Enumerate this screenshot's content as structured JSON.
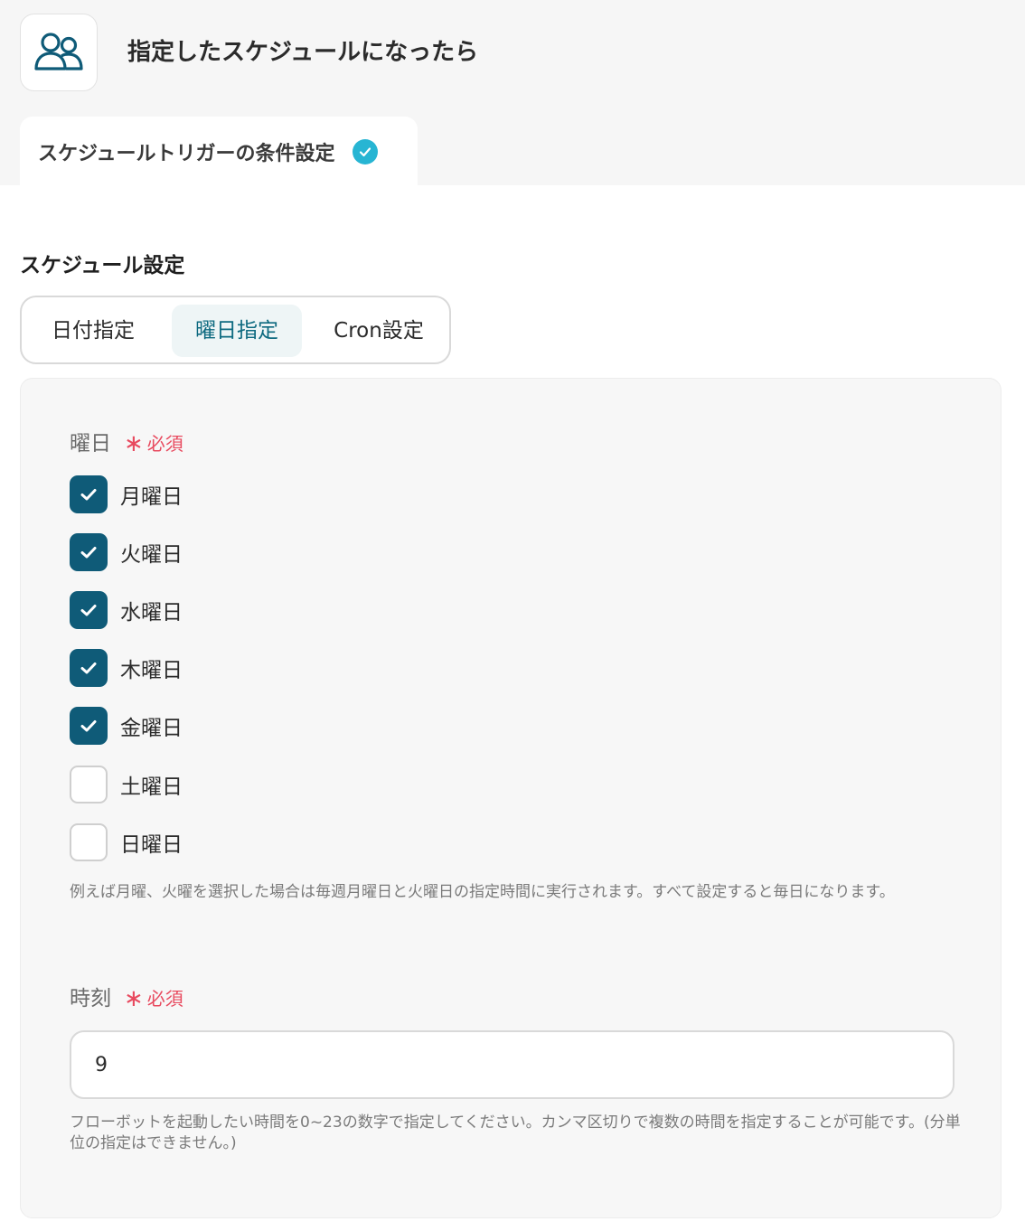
{
  "header": {
    "app_icon": "users-icon",
    "title": "指定したスケジュールになったら"
  },
  "section_tab": {
    "label": "スケジュールトリガーの条件設定",
    "status_icon": "check-circle-icon",
    "status_color": "#27b5d3"
  },
  "schedule": {
    "title": "スケジュール設定",
    "modes": [
      "日付指定",
      "曜日指定",
      "Cron設定"
    ],
    "active_mode": "曜日指定"
  },
  "weekday_field": {
    "label": "曜日",
    "required_label": "必須",
    "options": [
      {
        "label": "月曜日",
        "checked": true
      },
      {
        "label": "火曜日",
        "checked": true
      },
      {
        "label": "水曜日",
        "checked": true
      },
      {
        "label": "木曜日",
        "checked": true
      },
      {
        "label": "金曜日",
        "checked": true
      },
      {
        "label": "土曜日",
        "checked": false
      },
      {
        "label": "日曜日",
        "checked": false
      }
    ],
    "help": "例えば月曜、火曜を選択した場合は毎週月曜日と火曜日の指定時間に実行されます。すべて設定すると毎日になります。"
  },
  "time_field": {
    "label": "時刻",
    "required_label": "必須",
    "value": "9",
    "help": "フローボットを起動したい時間を0~23の数字で指定してください。カンマ区切りで複数の時間を指定することが可能です。(分単位の指定はできません。)"
  },
  "colors": {
    "accent": "#0f5b78",
    "required": "#e84a5f",
    "active_tab_bg": "#eef5f6"
  }
}
